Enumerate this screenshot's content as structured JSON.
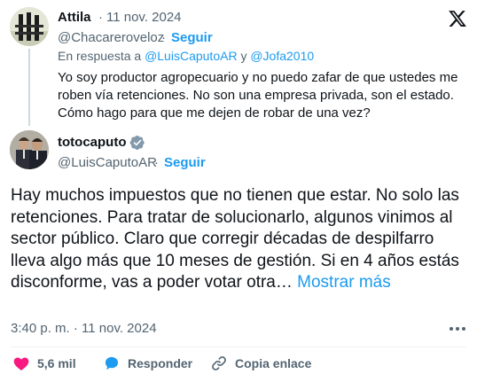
{
  "reply": {
    "author_name": "Attila",
    "date": "11 nov. 2024",
    "handle": "@Chacareroveloz",
    "follow_label": "Seguir",
    "reply_prefix": "En respuesta a",
    "reply_mentions": "@LuisCaputoAR",
    "reply_conjunction": "y",
    "reply_mentions_2": "@Jofa2010",
    "text": "Yo soy productor agropecuario y no puedo zafar de que ustedes me roben vía retenciones. No son una empresa privada, son el estado. Cómo hago para que me dejen de robar de una vez?"
  },
  "original": {
    "author_name": "totocaputo",
    "handle": "@LuisCaputoAR",
    "follow_label": "Seguir",
    "text": "Hay muchos impuestos que no tienen que estar. No solo las retenciones. Para tratar de solucionarlo, algunos vinimos al sector público.  Claro que corregir décadas de despilfarro lleva algo más que 10 meses de gestión. Si en 4 años estás disconforme, vas a poder votar otra…",
    "more_label": "Mostrar más",
    "timestamp": "3:40 p. m. · 11 nov. 2024"
  },
  "actions": {
    "likes": "5,6 mil",
    "reply_label": "Responder",
    "copy_label": "Copia enlace"
  },
  "colors": {
    "accent": "#1d9bf0",
    "like": "#f91880",
    "muted": "#536471",
    "verified": "#829aab"
  },
  "icons": {
    "brand": "x-logo-icon",
    "verified": "verified-badge-icon",
    "more": "more-dots-icon",
    "like": "heart-icon",
    "reply": "reply-bubble-icon",
    "copy": "link-icon"
  }
}
